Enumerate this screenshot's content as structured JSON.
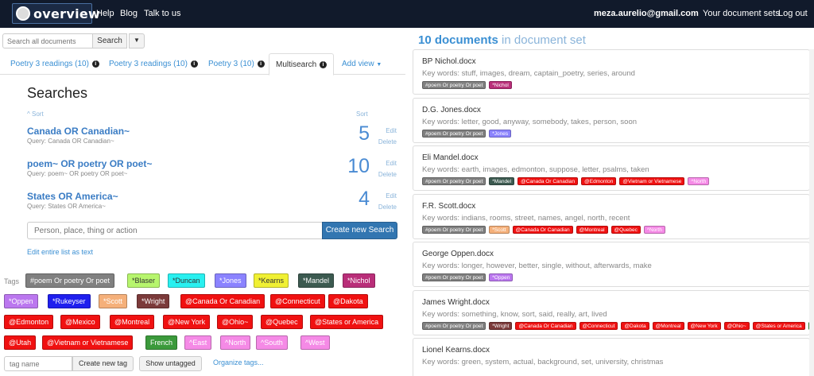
{
  "nav": {
    "logo_text": "overview",
    "links": [
      "Help",
      "Blog",
      "Talk to us"
    ],
    "user_email": "meza.aurelio@gmail.com",
    "document_sets": "Your document sets",
    "logout": "Log out"
  },
  "search": {
    "placeholder": "Search all documents",
    "button": "Search"
  },
  "tabs": [
    {
      "label": "Poetry 3 readings (10)",
      "active": false
    },
    {
      "label": "Poetry 3 readings (10)",
      "active": false
    },
    {
      "label": "Poetry 3 (10)",
      "active": false
    },
    {
      "label": "Multisearch",
      "active": true
    },
    {
      "label": "Add view",
      "active": false
    }
  ],
  "searches": {
    "title": "Searches",
    "sort_name": "Sort",
    "sort_count": "Sort",
    "items": [
      {
        "name": "Canada OR Canadian~",
        "query": "Query: Canada OR Canadian~",
        "count": "5"
      },
      {
        "name": "poem~ OR poetry OR poet~",
        "query": "Query: poem~ OR poetry OR poet~",
        "count": "10"
      },
      {
        "name": "States OR America~",
        "query": "Query: States OR America~",
        "count": "4"
      }
    ],
    "edit_label": "Edit",
    "delete_label": "Delete",
    "input_placeholder": "Person, place, thing or action",
    "create_button": "Create new Search",
    "edit_list": "Edit entire list as text"
  },
  "tags_panel": {
    "label": "Tags",
    "tags": [
      {
        "label": "#poem Or poetry Or poet",
        "bg": "#808080",
        "fg": "#ffffff"
      },
      {
        "label": "*Blaser",
        "bg": "#b7f56d",
        "fg": "#333333"
      },
      {
        "label": "*Duncan",
        "bg": "#29f0f0",
        "fg": "#333333"
      },
      {
        "label": "*Jones",
        "bg": "#8b83ff",
        "fg": "#ffffff"
      },
      {
        "label": "*Kearns",
        "bg": "#f0f033",
        "fg": "#333333"
      },
      {
        "label": "*Mandel",
        "bg": "#3c5a50",
        "fg": "#ffffff"
      },
      {
        "label": "*Nichol",
        "bg": "#b92e79",
        "fg": "#ffffff"
      },
      {
        "label": "*Oppen",
        "bg": "#bb77ef",
        "fg": "#ffffff"
      },
      {
        "label": "*Rukeyser",
        "bg": "#1f1fee",
        "fg": "#ffffff"
      },
      {
        "label": "*Scott",
        "bg": "#f5b07a",
        "fg": "#ffffff"
      },
      {
        "label": "*Wright",
        "bg": "#7b3a3a",
        "fg": "#ffffff"
      },
      {
        "label": "@Canada Or Canadian",
        "bg": "#f01111",
        "fg": "#ffffff"
      },
      {
        "label": "@Connecticut",
        "bg": "#f01111",
        "fg": "#ffffff"
      },
      {
        "label": "@Dakota",
        "bg": "#f01111",
        "fg": "#ffffff"
      },
      {
        "label": "@Edmonton",
        "bg": "#f01111",
        "fg": "#ffffff"
      },
      {
        "label": "@Mexico",
        "bg": "#f01111",
        "fg": "#ffffff"
      },
      {
        "label": "@Montreal",
        "bg": "#f01111",
        "fg": "#ffffff"
      },
      {
        "label": "@New York",
        "bg": "#f01111",
        "fg": "#ffffff"
      },
      {
        "label": "@Ohio~",
        "bg": "#f01111",
        "fg": "#ffffff"
      },
      {
        "label": "@Quebec",
        "bg": "#f01111",
        "fg": "#ffffff"
      },
      {
        "label": "@States or America",
        "bg": "#f01111",
        "fg": "#ffffff"
      },
      {
        "label": "@Utah",
        "bg": "#f01111",
        "fg": "#ffffff"
      },
      {
        "label": "@Vietnam or Vietnamese",
        "bg": "#f01111",
        "fg": "#ffffff"
      },
      {
        "label": "French",
        "bg": "#3b9a3b",
        "fg": "#ffffff"
      },
      {
        "label": "^East",
        "bg": "#f58ae6",
        "fg": "#ffffff"
      },
      {
        "label": "^North",
        "bg": "#f58ae6",
        "fg": "#ffffff"
      },
      {
        "label": "^South",
        "bg": "#f58ae6",
        "fg": "#ffffff"
      },
      {
        "label": "^West",
        "bg": "#f58ae6",
        "fg": "#ffffff"
      }
    ],
    "tag_input_placeholder": "tag name",
    "create_tag": "Create new tag",
    "show_untagged": "Show untagged",
    "organize": "Organize tags..."
  },
  "documents": {
    "count_text": "10 documents",
    "suffix": "in document set",
    "items": [
      {
        "title": "BP Nichol.docx",
        "keywords": "Key words: stuff, images, dream, captain_poetry, series, around",
        "tags": [
          0,
          6
        ]
      },
      {
        "title": "D.G. Jones.docx",
        "keywords": "Key words: letter, good, anyway, somebody, takes, person, soon",
        "tags": [
          0,
          3
        ]
      },
      {
        "title": "Eli Mandel.docx",
        "keywords": "Key words: earth, images, edmonton, suppose, letter, psalms, taken",
        "tags": [
          0,
          5,
          11,
          14,
          22,
          25
        ]
      },
      {
        "title": "F.R. Scott.docx",
        "keywords": "Key words: indians, rooms, street, names, angel, north, recent",
        "tags": [
          0,
          9,
          11,
          16,
          19,
          25
        ]
      },
      {
        "title": "George Oppen.docx",
        "keywords": "Key words: longer, however, better, single, without, afterwards, make",
        "tags": [
          0,
          7
        ]
      },
      {
        "title": "James Wright.docx",
        "keywords": "Key words: something, know, sort, said, really, art, lived",
        "tags": [
          0,
          10,
          11,
          12,
          13,
          16,
          17,
          18,
          20,
          23,
          24,
          25,
          26,
          27
        ]
      },
      {
        "title": "Lionel Kearns.docx",
        "keywords": "Key words: green, system, actual, background, set, university, christmas",
        "tags": []
      }
    ]
  }
}
